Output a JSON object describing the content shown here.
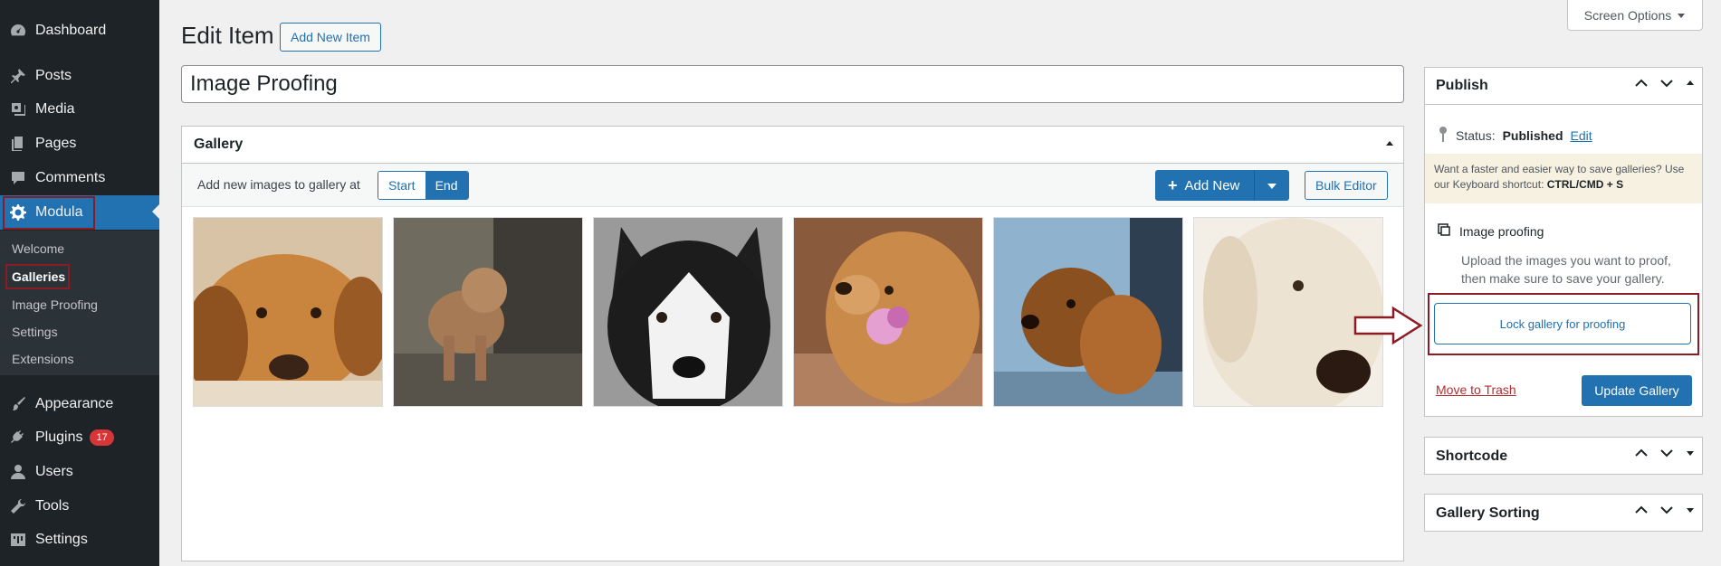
{
  "sidebar": {
    "items": [
      {
        "label": "Dashboard",
        "icon": "dashboard-icon"
      },
      {
        "label": "Posts",
        "icon": "pin-icon"
      },
      {
        "label": "Media",
        "icon": "media-icon"
      },
      {
        "label": "Pages",
        "icon": "pages-icon"
      },
      {
        "label": "Comments",
        "icon": "comment-icon"
      },
      {
        "label": "Modula",
        "icon": "gear-icon"
      },
      {
        "label": "Appearance",
        "icon": "brush-icon"
      },
      {
        "label": "Plugins",
        "icon": "plug-icon",
        "badge": "17"
      },
      {
        "label": "Users",
        "icon": "user-icon"
      },
      {
        "label": "Tools",
        "icon": "wrench-icon"
      },
      {
        "label": "Settings",
        "icon": "settings-icon"
      }
    ],
    "submenu": [
      "Welcome",
      "Galleries",
      "Image Proofing",
      "Settings",
      "Extensions"
    ],
    "colors": {
      "bg": "#1d2327",
      "active": "#2271b1",
      "highlight": "#8c1c24",
      "badge": "#d63638"
    }
  },
  "header": {
    "title": "Edit Item",
    "add_new_label": "Add New Item",
    "screen_options_label": "Screen Options"
  },
  "post_title": "Image Proofing",
  "gallery": {
    "title": "Gallery",
    "toolbar_label": "Add new images to gallery at",
    "position_options": [
      "Start",
      "End"
    ],
    "position_selected": "End",
    "add_new_label": "Add New",
    "bulk_editor_label": "Bulk Editor",
    "images": [
      "dog-photo-dachshund",
      "dog-photo-poodle",
      "dog-photo-husky",
      "dog-photo-golden-flower",
      "dog-photo-spaniel-car",
      "dog-photo-white-retriever"
    ]
  },
  "publish": {
    "title": "Publish",
    "status_label": "Status:",
    "status_value": "Published",
    "status_edit": "Edit",
    "shortcut_note": "Want a faster and easier way to save galleries? Use our Keyboard shortcut:",
    "shortcut_keys": "CTRL/CMD + S",
    "proofing_title": "Image proofing",
    "proofing_desc": "Upload the images you want to proof, then make sure to save your gallery.",
    "lock_label": "Lock gallery for proofing",
    "trash_label": "Move to Trash",
    "update_label": "Update Gallery"
  },
  "shortcode": {
    "title": "Shortcode"
  },
  "sorting": {
    "title": "Gallery Sorting"
  }
}
